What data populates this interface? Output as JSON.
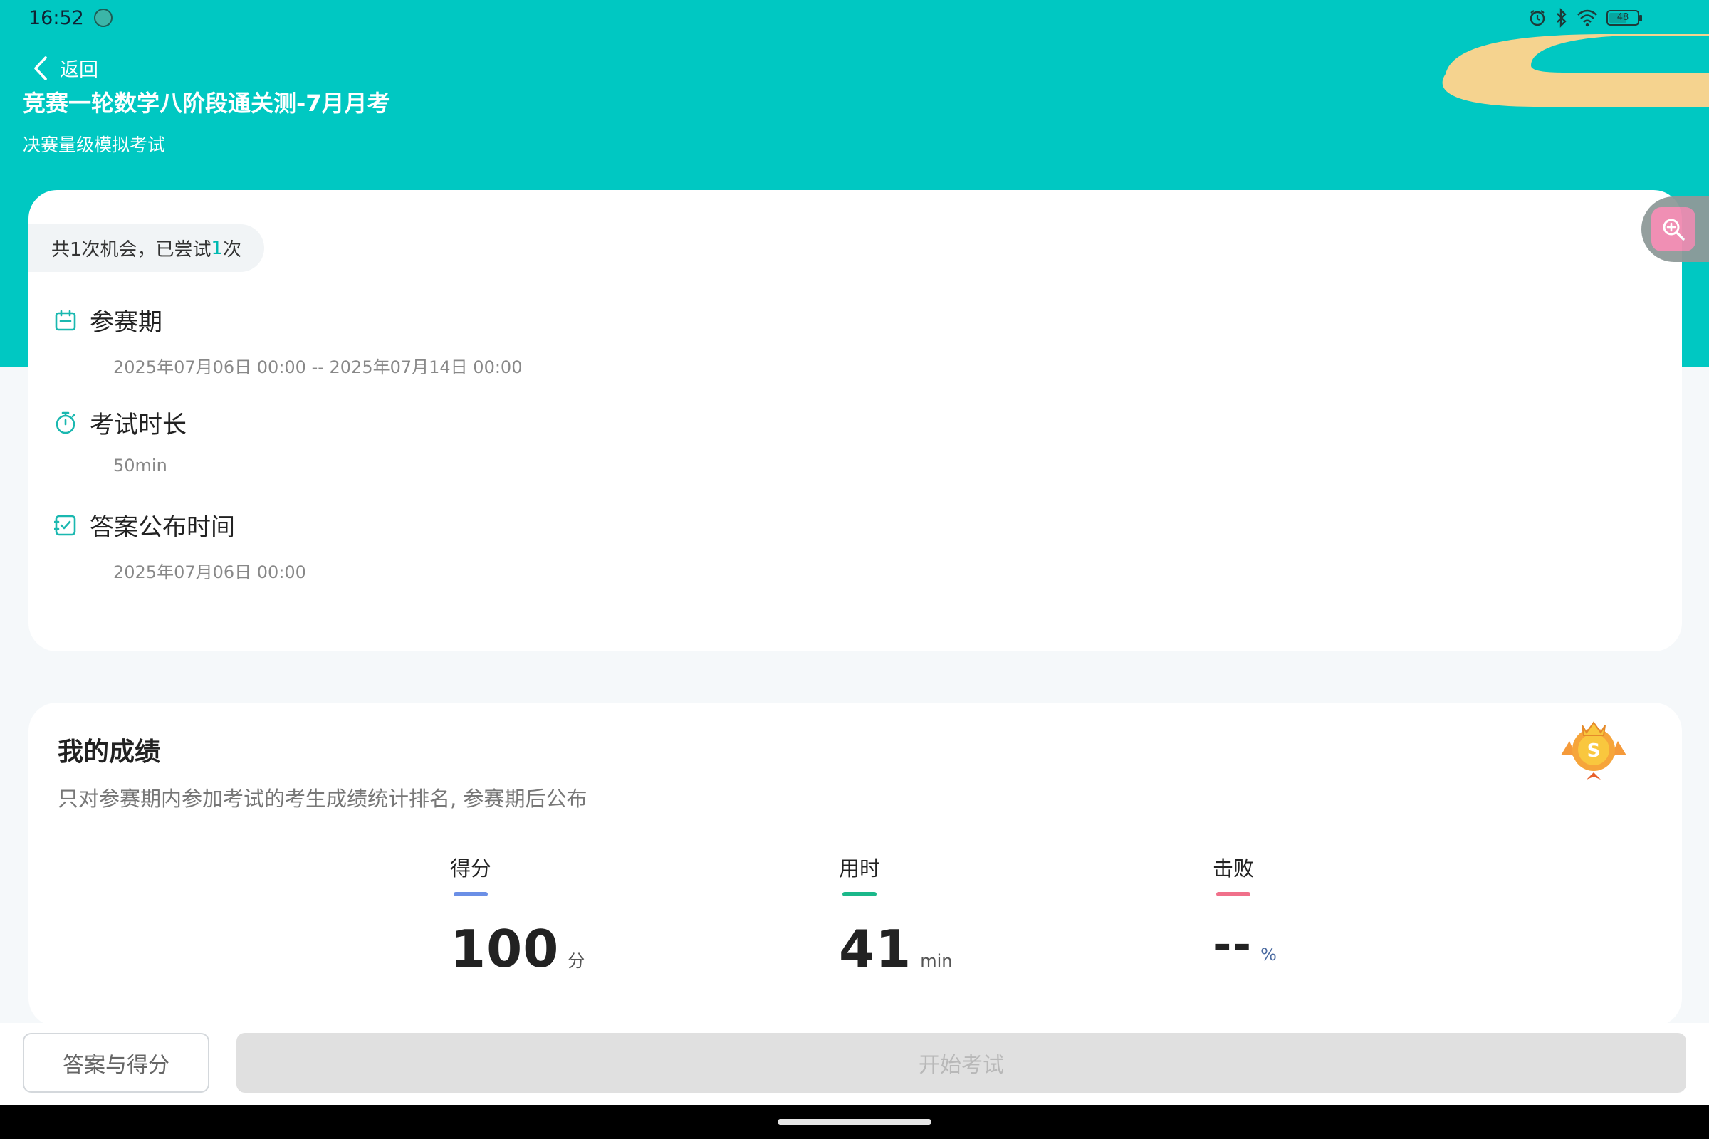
{
  "status_bar": {
    "time": "16:52",
    "battery": "48",
    "icons": [
      "app-icon",
      "alarm-icon",
      "bluetooth-icon",
      "wifi-icon",
      "battery-icon"
    ]
  },
  "header": {
    "back_label": "返回",
    "title": "竞赛一轮数学八阶段通关测-7月月考",
    "subtitle": "决赛量级模拟考试"
  },
  "info": {
    "attempts_prefix": "共1次机会，已尝试",
    "attempts_count": "1",
    "attempts_suffix": "次",
    "period_title": "参赛期",
    "period_value": "2025年07月06日 00:00  --  2025年07月14日 00:00",
    "duration_title": "考试时长",
    "duration_value": "50min",
    "answer_title": "答案公布时间",
    "answer_value": "2025年07月06日 00:00"
  },
  "score": {
    "title": "我的成绩",
    "description": "只对参赛期内参加考试的考生成绩统计排名, 参赛期后公布",
    "stats": [
      {
        "label": "得分",
        "value": "100",
        "unit": "分",
        "color": "#6b8fe6"
      },
      {
        "label": "用时",
        "value": "41",
        "unit": "min",
        "color": "#1ab88a"
      },
      {
        "label": "击败",
        "value": "--",
        "unit": "%",
        "color": "#f0708a"
      }
    ]
  },
  "actions": {
    "answers_button": "答案与得分",
    "start_button": "开始考试"
  },
  "colors": {
    "header": "#00c8c2",
    "accent": "#00b9b1"
  }
}
